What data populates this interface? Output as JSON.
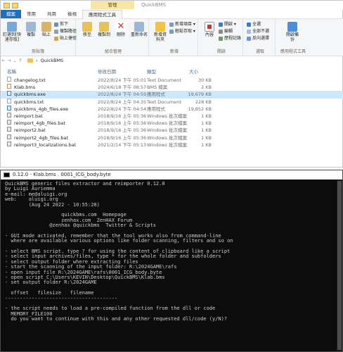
{
  "explorer": {
    "window_title": "QuickBMS",
    "contextual_tab_group": "管理",
    "tabs": [
      {
        "label": "檔案"
      },
      {
        "label": "常用"
      },
      {
        "label": "共用"
      },
      {
        "label": "檢視"
      },
      {
        "label": "應用程式工具"
      }
    ],
    "ribbon": {
      "clipboard": {
        "label": "剪貼簿",
        "pin": "釘選到[快速存取]",
        "copy": "複製",
        "paste": "貼上",
        "cut": "剪下",
        "copy_path": "複製路徑",
        "paste_shortcut": "貼上捷徑"
      },
      "organize": {
        "label": "組合管理",
        "move_to": "移至",
        "copy_to": "複製到",
        "delete": "刪除",
        "rename": "重新命名"
      },
      "new": {
        "label": "新增",
        "new_folder": "新增資料夾",
        "new_item": "新增項目 ▾",
        "easy_access": "輕鬆存取 ▾"
      },
      "open": {
        "label": "開啟",
        "properties": "內容",
        "open": "開啟 ▾",
        "edit": "編輯",
        "history": "歷程記錄"
      },
      "select": {
        "label": "選取",
        "select_all": "全選",
        "select_none": "全部不選",
        "invert": "反向選擇"
      },
      "app_tools": {
        "label": "應用程式工具",
        "enable_backup": "開啟備份"
      }
    },
    "address": {
      "path": "QuickBMS"
    },
    "columns": {
      "name": "名稱",
      "modified": "修改日期",
      "type": "類型",
      "size": "大小"
    },
    "files": [
      {
        "name": "changelog.txt",
        "modified": "2022/8/24 下午 05:01",
        "type": "Text Document",
        "size": "30 KB",
        "icon": "txt"
      },
      {
        "name": "Klab.bms",
        "modified": "2024/6/18 下午 08:57",
        "type": "BMS 檔案",
        "size": "2 KB",
        "icon": "bms"
      },
      {
        "name": "quickbms.exe",
        "modified": "2022/8/24 下午 04:59",
        "type": "應用程式",
        "size": "19,679 KB",
        "icon": "exe",
        "selected": true
      },
      {
        "name": "quickbms.txt",
        "modified": "2022/8/24 上午 04:35",
        "type": "Text Document",
        "size": "228 KB",
        "icon": "txt"
      },
      {
        "name": "quickbms_4gb_files.exe",
        "modified": "2022/8/24 下午 04:54",
        "type": "應用程式",
        "size": "19,852 KB",
        "icon": "exe"
      },
      {
        "name": "reimport.bat",
        "modified": "2018/9/16 上午 05:36",
        "type": "Windows 批次檔案",
        "size": "1 KB",
        "icon": "bat"
      },
      {
        "name": "reimport_4gb_files.bat",
        "modified": "2018/9/16 上午 05:36",
        "type": "Windows 批次檔案",
        "size": "1 KB",
        "icon": "bat"
      },
      {
        "name": "reimport2.bat",
        "modified": "2018/9/16 上午 05:36",
        "type": "Windows 批次檔案",
        "size": "1 KB",
        "icon": "bat"
      },
      {
        "name": "reimport2_4gb_files.bat",
        "modified": "2018/9/16 上午 05:36",
        "type": "Windows 批次檔案",
        "size": "1 KB",
        "icon": "bat"
      },
      {
        "name": "reimport3_localizations.bat",
        "modified": "2021/2/14 下午 05:13",
        "type": "Windows 批次檔案",
        "size": "1 KB",
        "icon": "bat"
      }
    ]
  },
  "console": {
    "title": "0.12.0 - Klab.bms . 0001_ICG_body.byte",
    "lines": [
      "QuickBMS generic files extractor and reimporter 0.12.0",
      "by Luigi Auriemma",
      "e-mail: me@aluigi.org",
      "web:    aluigi.org",
      "        (Aug 24 2022 - 10:55:28)",
      "",
      "                   quickbms.com  Homepage",
      "                   zenhax.com  ZenHAX Forum",
      "               @zenhax @quickbms  Twitter & Scripts",
      "",
      "- GUI mode activated, remember that the tool works also from command-line",
      "  where are available various options like folder scanning, filters and so on",
      "",
      "- select BMS script. type ? for using the content of clipboard like a script",
      "- select input archives/files, type * for the whole folder and subfolders",
      "- select output folder where extracting files",
      "- start the scanning of the input folder: R:\\2024GAME\\rafs",
      "- open input file R:\\2024GAME\\rafs\\0001_ICG_body.byte",
      "- open script C:\\Users\\KEVIN\\Desktop\\QuickBMS\\Klab.bms",
      "- set output folder R:\\2024GAME",
      "",
      "  offset   filesize   filename",
      "--------------------------------------",
      "",
      "- the script needs to load a pre-compiled function from the dll or code",
      "  MEMORY_FILE100",
      "  do you want to continue with this and any other requested dll/code (y/N)?"
    ]
  }
}
